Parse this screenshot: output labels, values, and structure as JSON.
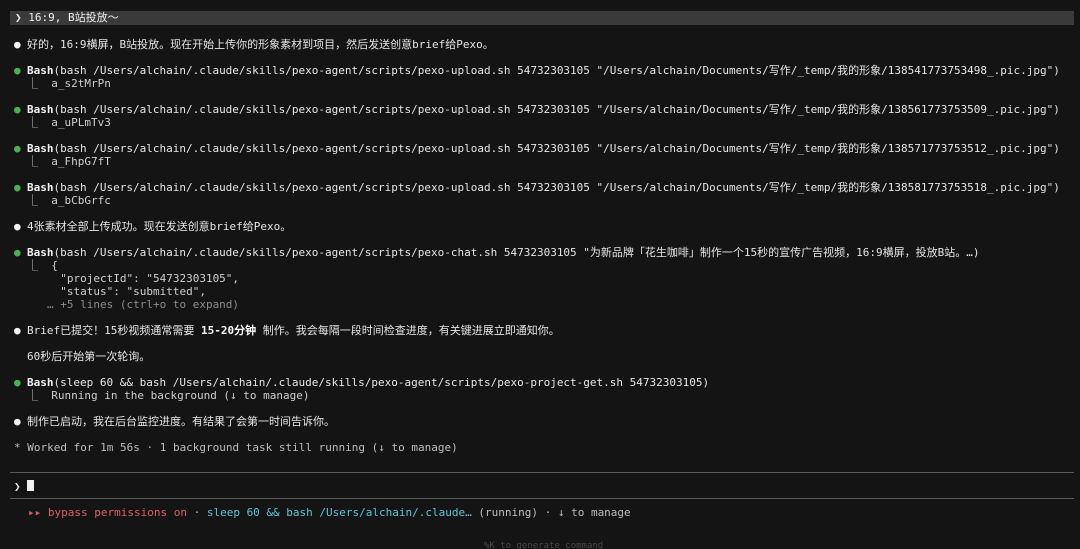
{
  "user_prompt": "16:9, B站投放～",
  "prompt_symbol": "❯",
  "messages": [
    {
      "text": "好的，16:9横屏，B站投放。现在开始上传你的形象素材到项目，然后发送创意brief给Pexo。"
    },
    {
      "tool": "Bash",
      "command": "(bash /Users/alchain/.claude/skills/pexo-agent/scripts/pexo-upload.sh 54732303105 \"/Users/alchain/Documents/写作/_temp/我的形象/138541773753498_.pic.jpg\")",
      "result": "a_s2tMrPn"
    },
    {
      "tool": "Bash",
      "command": "(bash /Users/alchain/.claude/skills/pexo-agent/scripts/pexo-upload.sh 54732303105 \"/Users/alchain/Documents/写作/_temp/我的形象/138561773753509_.pic.jpg\")",
      "result": "a_uPLmTv3"
    },
    {
      "tool": "Bash",
      "command": "(bash /Users/alchain/.claude/skills/pexo-agent/scripts/pexo-upload.sh 54732303105 \"/Users/alchain/Documents/写作/_temp/我的形象/138571773753512_.pic.jpg\")",
      "result": "a_FhpG7fT"
    },
    {
      "tool": "Bash",
      "command": "(bash /Users/alchain/.claude/skills/pexo-agent/scripts/pexo-upload.sh 54732303105 \"/Users/alchain/Documents/写作/_temp/我的形象/138581773753518_.pic.jpg\")",
      "result": "a_bCbGrfc"
    },
    {
      "text": "4张素材全部上传成功。现在发送创意brief给Pexo。"
    },
    {
      "tool": "Bash",
      "command": "(bash /Users/alchain/.claude/skills/pexo-agent/scripts/pexo-chat.sh 54732303105 \"为新品牌「花生咖啡」制作一个15秒的宣传广告视频，16:9横屏，投放B站。…)",
      "result_lines": [
        "{",
        "  \"projectId\": \"54732303105\",",
        "  \"status\": \"submitted\","
      ],
      "expand_hint": "… +5 lines (ctrl+o to expand)"
    },
    {
      "text_pre": "Brief已提交！15秒视频通常需要 ",
      "text_bold": "15-20分钟",
      "text_post": " 制作。我会每隔一段时间检查进度，有关键进展立即通知你。"
    },
    {
      "plain": "60秒后开始第一次轮询。"
    },
    {
      "tool": "Bash",
      "command": "(sleep 60 && bash /Users/alchain/.claude/skills/pexo-agent/scripts/pexo-project-get.sh 54732303105)",
      "result": "Running in the background (↓ to manage)"
    },
    {
      "text": "制作已启动，我在后台监控进度。有结果了会第一时间告诉你。"
    }
  ],
  "worked_status": "* Worked for 1m 56s · 1 background task still running (↓ to manage)",
  "input_prompt": "❯",
  "footer": {
    "arrows": "▸▸",
    "mode": "bypass permissions on",
    "sep1": " · ",
    "task": "sleep 60 && bash /Users/alchain/.claude…",
    "state": " (running) · ↓ to manage"
  },
  "faint_hint": "%K to generate command",
  "colors": {
    "background": "#141414",
    "bullet_green": "#4caf50",
    "red": "#e05d66",
    "cyan": "#5ac8d8"
  }
}
